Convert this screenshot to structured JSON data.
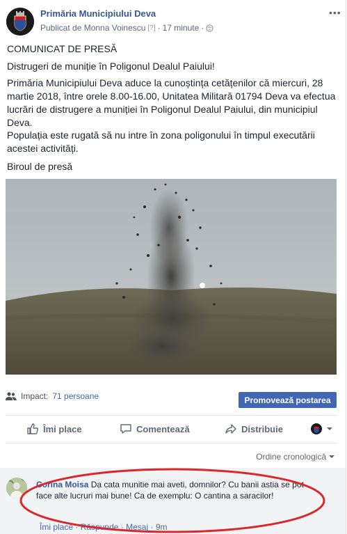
{
  "post": {
    "page_name": "Primăria Municipiului Deva",
    "published_by": "Publicat de Monna Voinescu",
    "help_marker": "[?]",
    "time": "17 minute",
    "heading": "COMUNICAT DE PRESĂ",
    "subheading": "Distrugeri de muniție în Poligonul Dealul Paiului!",
    "paragraph1": "Primăria Municipiului Deva aduce la cunoștința cetățenilor că miercuri, 28 martie 2018, între orele 8.00-16.00, Unitatea Militară 01794 Deva va efectua lucrări de distrugere a muniției în Poligonul Dealul Paiului, din municipiul Deva.",
    "paragraph2": "Populația este rugată să nu intre în zona poligonului în timpul executării acestei activități.",
    "signature": "Biroul de presă"
  },
  "stats": {
    "impact_label": "Impact:",
    "impact_value": "71 persoane",
    "promote_label": "Promovează postarea"
  },
  "actions": {
    "like": "Îmi place",
    "comment": "Comentează",
    "share": "Distribuie"
  },
  "comments_section": {
    "sort_label": "Ordine cronologică"
  },
  "comment": {
    "author": "Corina Moisa",
    "text": "Da cata munitie mai aveti, domnilor? Cu banii astia se pot face alte lucruri mai bune! Ca de exemplu: O cantina a saracilor!",
    "like": "Îmi place",
    "reply": "Răspunde",
    "message": "Mesaj",
    "time": "9m",
    "sep": "·"
  },
  "colors": {
    "link": "#365899",
    "promote_bg": "#4267b2",
    "highlight_oval": "#d9272e"
  }
}
